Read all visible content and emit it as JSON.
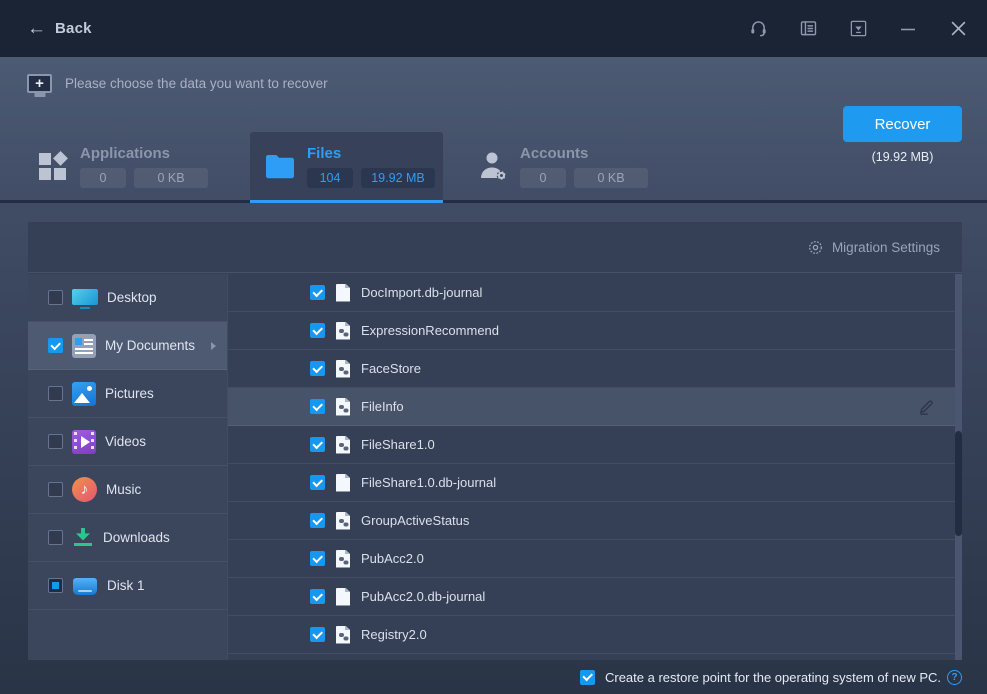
{
  "titlebar": {
    "back_label": "Back"
  },
  "header": {
    "prompt": "Please choose the data you want to recover"
  },
  "tabs": [
    {
      "label": "Applications",
      "count": "0",
      "size": "0 KB",
      "active": false
    },
    {
      "label": "Files",
      "count": "104",
      "size": "19.92 MB",
      "active": true
    },
    {
      "label": "Accounts",
      "count": "0",
      "size": "0 KB",
      "active": false
    }
  ],
  "recover": {
    "button_label": "Recover",
    "total_size": "(19.92 MB)"
  },
  "panel": {
    "migration_settings_label": "Migration Settings"
  },
  "sidebar": {
    "items": [
      {
        "label": "Desktop",
        "icon": "desktop",
        "checked": "off",
        "selected": false,
        "has_arrow": false
      },
      {
        "label": "My Documents",
        "icon": "documents",
        "checked": "on",
        "selected": true,
        "has_arrow": true
      },
      {
        "label": "Pictures",
        "icon": "pictures",
        "checked": "off",
        "selected": false,
        "has_arrow": false
      },
      {
        "label": "Videos",
        "icon": "videos",
        "checked": "off",
        "selected": false,
        "has_arrow": false
      },
      {
        "label": "Music",
        "icon": "music",
        "checked": "off",
        "selected": false,
        "has_arrow": false
      },
      {
        "label": "Downloads",
        "icon": "downloads",
        "checked": "off",
        "selected": false,
        "has_arrow": false
      },
      {
        "label": "Disk 1",
        "icon": "disk",
        "checked": "mixed",
        "selected": false,
        "has_arrow": false
      }
    ]
  },
  "files": {
    "rows": [
      {
        "name": "DocImport.db-journal",
        "icon": "file-plain",
        "checked": true,
        "highlighted": false,
        "has_edit": false
      },
      {
        "name": "ExpressionRecommend",
        "icon": "file-gear",
        "checked": true,
        "highlighted": false,
        "has_edit": false
      },
      {
        "name": "FaceStore",
        "icon": "file-gear",
        "checked": true,
        "highlighted": false,
        "has_edit": false
      },
      {
        "name": "FileInfo",
        "icon": "file-gear",
        "checked": true,
        "highlighted": true,
        "has_edit": true
      },
      {
        "name": "FileShare1.0",
        "icon": "file-gear",
        "checked": true,
        "highlighted": false,
        "has_edit": false
      },
      {
        "name": "FileShare1.0.db-journal",
        "icon": "file-plain",
        "checked": true,
        "highlighted": false,
        "has_edit": false
      },
      {
        "name": "GroupActiveStatus",
        "icon": "file-gear",
        "checked": true,
        "highlighted": false,
        "has_edit": false
      },
      {
        "name": "PubAcc2.0",
        "icon": "file-gear",
        "checked": true,
        "highlighted": false,
        "has_edit": false
      },
      {
        "name": "PubAcc2.0.db-journal",
        "icon": "file-plain",
        "checked": true,
        "highlighted": false,
        "has_edit": false
      },
      {
        "name": "Registry2.0",
        "icon": "file-gear",
        "checked": true,
        "highlighted": false,
        "has_edit": false
      }
    ]
  },
  "footer": {
    "restore_point_label": "Create a restore point for the operating system of new PC.",
    "checked": true,
    "help_glyph": "?"
  },
  "colors": {
    "accent": "#1E9AF0",
    "active_tab": "#2E9DF5",
    "titlebar": "#1B2435",
    "panel": "#353F56"
  }
}
